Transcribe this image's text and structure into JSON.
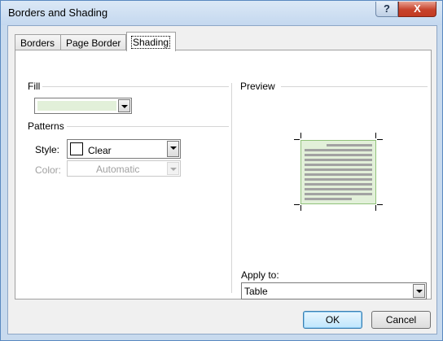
{
  "window": {
    "title": "Borders and Shading",
    "help_glyph": "?",
    "close_glyph": "X"
  },
  "tabs": [
    {
      "label": "Borders",
      "active": false
    },
    {
      "label": "Page Border",
      "active": false
    },
    {
      "label": "Shading",
      "active": true
    }
  ],
  "fill": {
    "group_label": "Fill",
    "color": "#e2f0d9"
  },
  "patterns": {
    "group_label": "Patterns",
    "style_label": "Style:",
    "style_value": "Clear",
    "color_label": "Color:",
    "color_value": "Automatic"
  },
  "preview": {
    "group_label": "Preview",
    "apply_to_label": "Apply to:",
    "apply_to_value": "Table",
    "shading_color": "#e2f0d9"
  },
  "buttons": {
    "ok": "OK",
    "cancel": "Cancel"
  }
}
